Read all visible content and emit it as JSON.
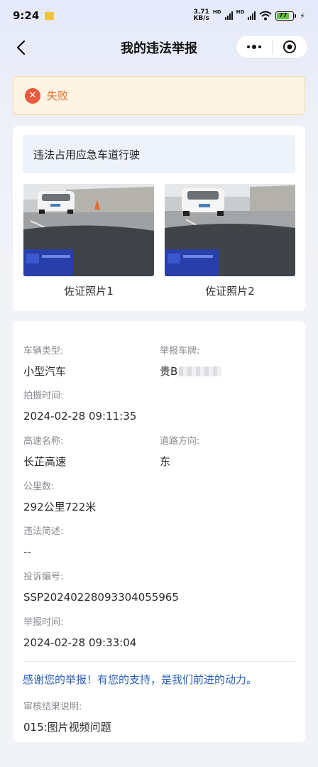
{
  "status_bar": {
    "time": "9:24",
    "net_speed": "3.71",
    "net_unit": "KB/s",
    "hd1": "HD",
    "hd2": "HD",
    "battery": "77"
  },
  "nav": {
    "title": "我的违法举报"
  },
  "status": {
    "text": "失败",
    "color": "#e66f2b"
  },
  "violation": {
    "title": "违法占用应急车道行驶"
  },
  "photos": [
    {
      "label": "佐证照片1"
    },
    {
      "label": "佐证照片2"
    }
  ],
  "details": {
    "vehicle_type": {
      "label": "车辆类型:",
      "value": "小型汽车"
    },
    "plate": {
      "label": "举报车牌:",
      "value": "贵B"
    },
    "capture_time": {
      "label": "拍摄时间:",
      "value": "2024-02-28 09:11:35"
    },
    "highway": {
      "label": "高速名称:",
      "value": "长芷高速"
    },
    "direction": {
      "label": "道路方向:",
      "value": "东"
    },
    "mileage": {
      "label": "公里数:",
      "value": "292公里722米"
    },
    "description": {
      "label": "违法简述:",
      "value": "--"
    },
    "complaint_no": {
      "label": "投诉编号:",
      "value": "SSP20240228093304055965"
    },
    "report_time": {
      "label": "举报时间:",
      "value": "2024-02-28 09:33:04"
    },
    "thanks": "感谢您的举报！有您的支持，是我们前进的动力。",
    "review": {
      "label": "审核结果说明:",
      "value": "015:图片视频问题"
    }
  },
  "colors": {
    "accent_blue": "#2b5fb8",
    "fail_red": "#ea5a3c",
    "banner_bg": "#fdf4e3"
  }
}
